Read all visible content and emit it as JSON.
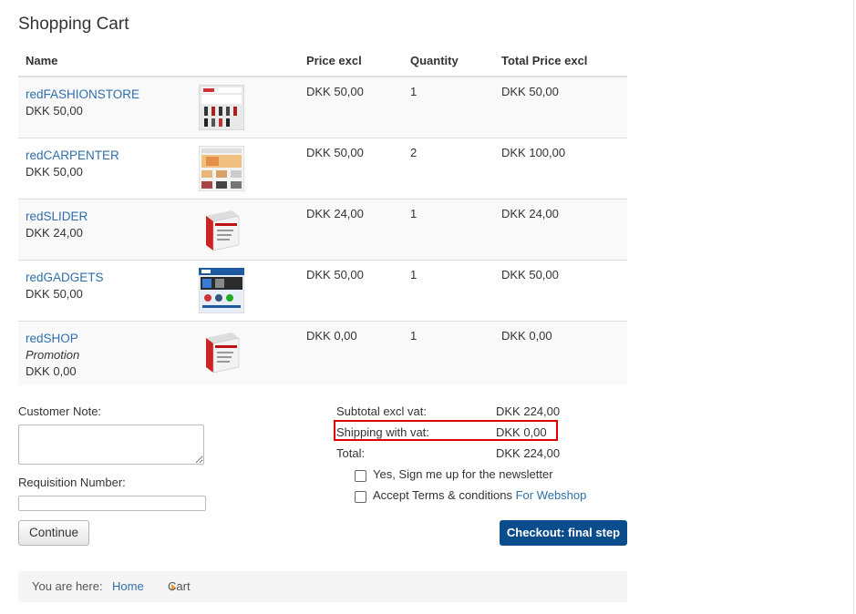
{
  "page_title": "Shopping Cart",
  "table": {
    "headers": [
      "Name",
      "",
      "Price excl",
      "Quantity",
      "Total Price excl"
    ],
    "rows": [
      {
        "name": "redFASHIONSTORE",
        "sub_price": "DKK 50,00",
        "promo": "",
        "price": "DKK 50,00",
        "qty": "1",
        "total": "DKK 50,00",
        "thumb": "fashion"
      },
      {
        "name": "redCARPENTER",
        "sub_price": "DKK 50,00",
        "promo": "",
        "price": "DKK 50,00",
        "qty": "2",
        "total": "DKK 100,00",
        "thumb": "carpenter"
      },
      {
        "name": "redSLIDER",
        "sub_price": "DKK 24,00",
        "promo": "",
        "price": "DKK 24,00",
        "qty": "1",
        "total": "DKK 24,00",
        "thumb": "box"
      },
      {
        "name": "redGADGETS",
        "sub_price": "DKK 50,00",
        "promo": "",
        "price": "DKK 50,00",
        "qty": "1",
        "total": "DKK 50,00",
        "thumb": "gadgets"
      },
      {
        "name": "redSHOP",
        "sub_price": "DKK 0,00",
        "promo": "Promotion",
        "price": "DKK 0,00",
        "qty": "1",
        "total": "DKK 0,00",
        "thumb": "box"
      }
    ]
  },
  "form": {
    "customer_note_label": "Customer Note:",
    "customer_note_value": "",
    "requisition_label": "Requisition Number:",
    "requisition_value": "",
    "continue_label": "Continue"
  },
  "summary": {
    "subtotal_label": "Subtotal excl vat:",
    "subtotal_value": "DKK 224,00",
    "shipping_label": "Shipping with vat:",
    "shipping_value": "DKK 0,00",
    "total_label": "Total:",
    "total_value": "DKK 224,00"
  },
  "options": {
    "newsletter_label": "Yes, Sign me up for the newsletter",
    "terms_label": "Accept Terms & conditions",
    "terms_link": "For Webshop",
    "checkout_label": "Checkout: final step"
  },
  "breadcrumb": {
    "prefix": "You are here:",
    "home": "Home",
    "current": "Cart"
  },
  "colors": {
    "link": "#2f6fab",
    "checkout_button": "#0b4c8c",
    "highlight": "#e00000",
    "breadcrumb_arrow": "#e79b2b"
  }
}
